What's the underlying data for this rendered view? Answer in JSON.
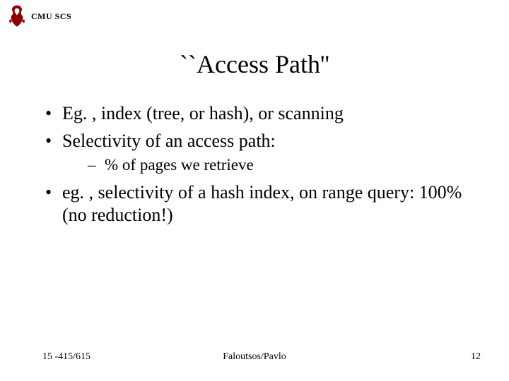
{
  "header": {
    "affiliation": "CMU SCS",
    "logo_name": "cmu-scotty-logo"
  },
  "title": "``Access Path''",
  "bullets": [
    {
      "text": "Eg. , index (tree, or hash), or scanning",
      "sub": []
    },
    {
      "text": "Selectivity of an access path:",
      "sub": [
        "% of pages we retrieve"
      ]
    },
    {
      "text": "eg. , selectivity of a hash index, on range query: 100% (no reduction!)",
      "sub": []
    }
  ],
  "footer": {
    "left": "15 -415/615",
    "center": "Faloutsos/Pavlo",
    "right": "12"
  }
}
